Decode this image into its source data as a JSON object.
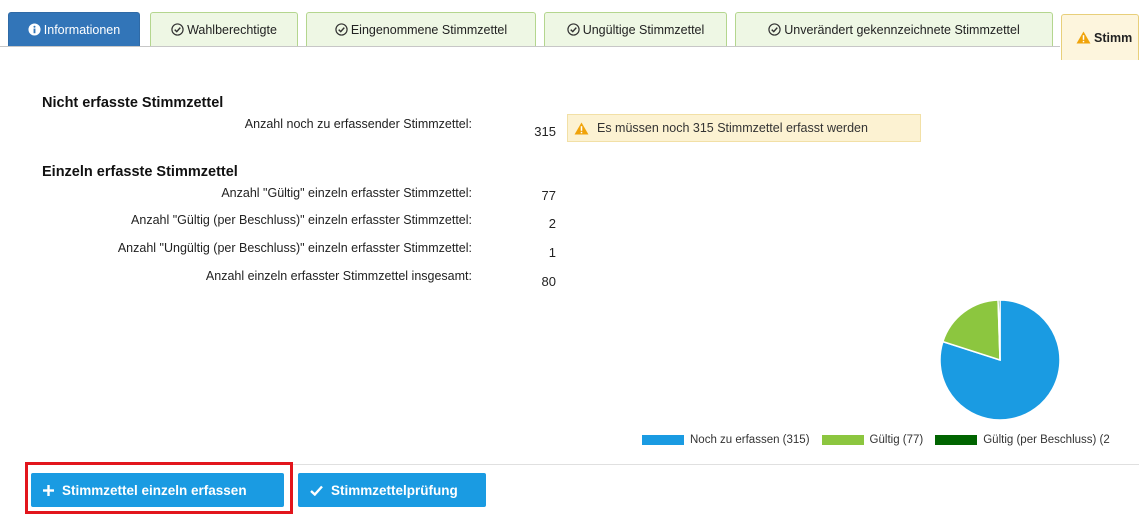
{
  "tabs": [
    {
      "label": "Informationen",
      "icon": "info-circle-icon",
      "state": "active"
    },
    {
      "label": "Wahlberechtigte",
      "icon": "check-circle-icon",
      "state": "ok"
    },
    {
      "label": "Eingenommene Stimmzettel",
      "icon": "check-circle-icon",
      "state": "ok"
    },
    {
      "label": "Ungültige Stimmzettel",
      "icon": "check-circle-icon",
      "state": "ok"
    },
    {
      "label": "Unverändert gekennzeichnete Stimmzettel",
      "icon": "check-circle-icon",
      "state": "ok"
    },
    {
      "label": "Stimm",
      "icon": "warning-icon",
      "state": "warn"
    }
  ],
  "not_recorded": {
    "title": "Nicht erfasste Stimmzettel",
    "label": "Anzahl noch zu erfassender Stimmzettel:",
    "value": "315",
    "alert": "Es müssen noch 315 Stimmzettel erfasst werden"
  },
  "individually_recorded": {
    "title": "Einzeln erfasste Stimmzettel",
    "rows": [
      {
        "label": "Anzahl \"Gültig\" einzeln erfasster Stimmzettel:",
        "value": "77"
      },
      {
        "label": "Anzahl \"Gültig (per Beschluss)\" einzeln erfasster Stimmzettel:",
        "value": "2"
      },
      {
        "label": "Anzahl \"Ungültig (per Beschluss)\" einzeln erfasster Stimmzettel:",
        "value": "1"
      },
      {
        "label": "Anzahl einzeln erfasster Stimmzettel insgesamt:",
        "value": "80"
      }
    ]
  },
  "chart_data": {
    "type": "pie",
    "series": [
      {
        "name": "Noch zu erfassen (315)",
        "value": 315,
        "color": "#1a9be2"
      },
      {
        "name": "Gültig (77)",
        "value": 77,
        "color": "#8cc63f"
      },
      {
        "name": "Gültig (per Beschluss) (2",
        "value": 2,
        "color": "#006400"
      }
    ],
    "legend_position": "bottom"
  },
  "buttons": {
    "record_individually": "Stimmzettel einzeln erfassen",
    "ballot_check": "Stimmzettelprüfung"
  },
  "colors": {
    "accent": "#1a9be2",
    "active_tab": "#3275b8",
    "ok_tab": "#eef7e4",
    "warn_tab": "#fdf5dd",
    "highlight": "#e2151c"
  }
}
